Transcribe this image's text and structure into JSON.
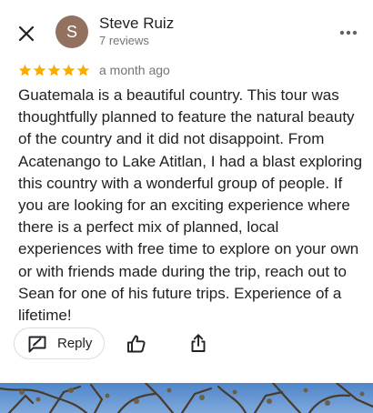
{
  "reviewer": {
    "initial": "S",
    "name": "Steve Ruiz",
    "meta": "7 reviews",
    "avatar_color": "#93715f"
  },
  "rating": {
    "stars": 5,
    "max": 5,
    "star_color": "#f9ab00",
    "date": "a month ago"
  },
  "review": {
    "text": "Guatemala is a beautiful country. This tour was thoughtfully planned to feature the natural beauty of the country and it did not disappoint. From Acatenango to Lake Atitlan, I had a blast exploring this country with a wonderful group of people. If you are looking for an exciting experience where there is a perfect mix of planned, local experiences with free time to explore on your own or with friends made during the trip, reach out to Sean for one of his future trips. Experience of a lifetime!"
  },
  "actions": {
    "reply_label": "Reply",
    "reply_icon": "reply-icon",
    "like_icon": "thumbs-up-icon",
    "share_icon": "share-icon"
  },
  "header": {
    "close_icon": "close-icon",
    "more_icon": "more-options-icon"
  }
}
